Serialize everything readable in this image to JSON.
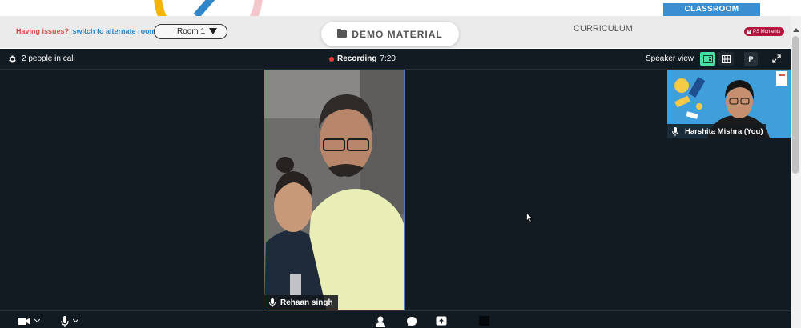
{
  "toolbar": {
    "issues_text": "Having issues?",
    "alternate_room_link": "switch to alternate room",
    "room_select_value": "Room 1",
    "demo_material_label": "DEMO MATERIAL",
    "curriculum_label": "CURRICULUM",
    "classroom_tab_label": "CLASSROOM",
    "ps_moments_label": "PS Moments"
  },
  "call": {
    "people_count_text": "2 people in call",
    "recording_label": "Recording",
    "recording_time": "7:20",
    "view_mode_label": "Speaker view",
    "presenter_button_label": "P"
  },
  "participants": {
    "main_name": "Rehaan singh",
    "self_name": "Harshita Mishra (You)"
  },
  "colors": {
    "call_background": "#131b22",
    "active_view_accent": "#48e0a4",
    "classroom_tab": "#3a8fd0",
    "ps_moments_badge": "#b5153d",
    "recording_dot": "#e83b3b"
  }
}
